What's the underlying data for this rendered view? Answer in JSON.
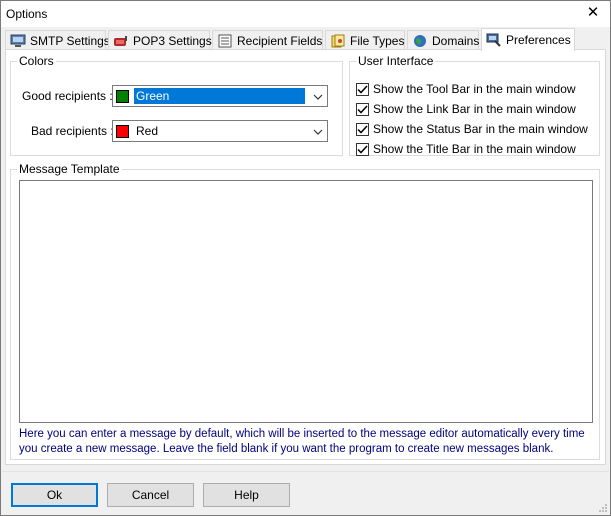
{
  "window": {
    "title": "Options",
    "close_glyph": "✕"
  },
  "tabs": [
    {
      "label": "SMTP Settings",
      "icon": "computer-icon",
      "active": false
    },
    {
      "label": "POP3 Settings",
      "icon": "mailbox-icon",
      "active": false
    },
    {
      "label": "Recipient Fields",
      "icon": "form-icon",
      "active": false
    },
    {
      "label": "File Types",
      "icon": "files-icon",
      "active": false
    },
    {
      "label": "Domains",
      "icon": "globe-icon",
      "active": false
    },
    {
      "label": "Preferences",
      "icon": "preferences-icon",
      "active": true
    }
  ],
  "colors_group": {
    "legend": "Colors",
    "good": {
      "label": "Good recipients :",
      "value": "Green",
      "swatch": "#008000"
    },
    "bad": {
      "label": "Bad recipients :",
      "value": "Red",
      "swatch": "#ff0000"
    }
  },
  "ui_group": {
    "legend": "User Interface",
    "options": [
      {
        "label": "Show the Tool Bar in the main window",
        "checked": true
      },
      {
        "label": "Show the Link Bar in the main window",
        "checked": true
      },
      {
        "label": "Show the Status Bar in the main window",
        "checked": true
      },
      {
        "label": "Show the Title Bar in the main window",
        "checked": true
      }
    ]
  },
  "template_group": {
    "legend": "Message Template",
    "value": "",
    "hint": "Here you can enter a message by default, which will be inserted to the message editor automatically every time you create a new message. Leave the field blank if you want the program to create new messages blank."
  },
  "buttons": {
    "ok": "Ok",
    "cancel": "Cancel",
    "help": "Help"
  },
  "accent_color": "#0078d7",
  "hint_color": "#000080"
}
